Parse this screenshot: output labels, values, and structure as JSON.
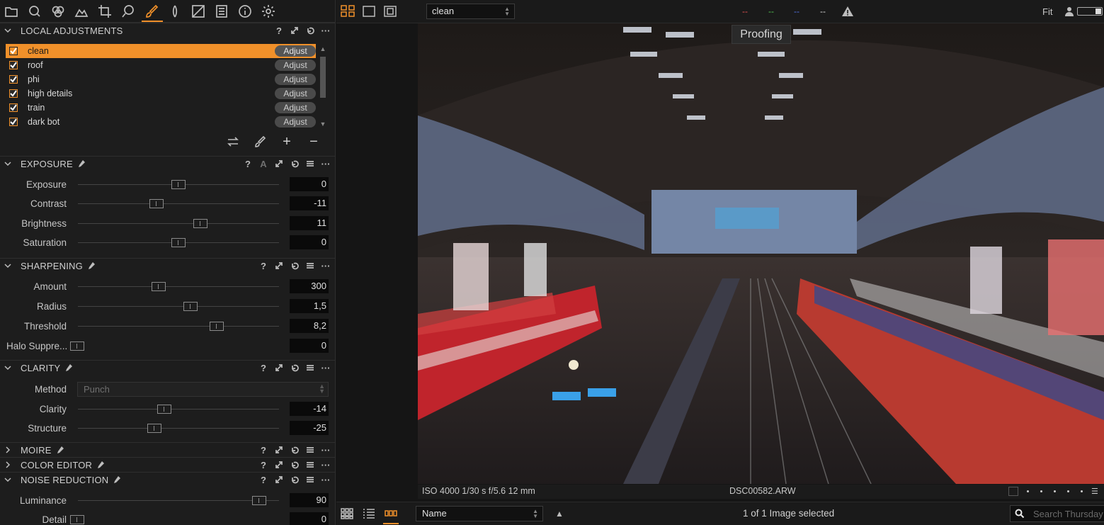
{
  "tool_tabs": [
    "folder-icon",
    "search-icon",
    "color-icon",
    "exposure-icon",
    "crop-icon",
    "lens-icon",
    "adjustments-brush-icon",
    "details-icon",
    "metadata-icon",
    "output-icon",
    "info-icon",
    "settings-icon"
  ],
  "local_adjustments": {
    "title": "LOCAL ADJUSTMENTS",
    "layers": [
      {
        "name": "clean",
        "action": "Adjust",
        "checked": true,
        "selected": true
      },
      {
        "name": "roof",
        "action": "Adjust",
        "checked": true,
        "selected": false
      },
      {
        "name": "phi",
        "action": "Adjust",
        "checked": true,
        "selected": false
      },
      {
        "name": "high details",
        "action": "Adjust",
        "checked": true,
        "selected": false
      },
      {
        "name": "train",
        "action": "Adjust",
        "checked": true,
        "selected": false
      },
      {
        "name": "dark bot",
        "action": "Adjust",
        "checked": true,
        "selected": false
      }
    ],
    "tools": [
      "+",
      "−"
    ]
  },
  "exposure": {
    "title": "EXPOSURE",
    "auto_label": "A",
    "sliders": [
      {
        "label": "Exposure",
        "value": "0",
        "pos": 0.5
      },
      {
        "label": "Contrast",
        "value": "-11",
        "pos": 0.39
      },
      {
        "label": "Brightness",
        "value": "11",
        "pos": 0.61
      },
      {
        "label": "Saturation",
        "value": "0",
        "pos": 0.5
      }
    ]
  },
  "sharpening": {
    "title": "SHARPENING",
    "sliders": [
      {
        "label": "Amount",
        "value": "300",
        "pos": 0.4
      },
      {
        "label": "Radius",
        "value": "1,5",
        "pos": 0.56
      },
      {
        "label": "Threshold",
        "value": "8,2",
        "pos": 0.69
      }
    ],
    "halo": {
      "label": "Halo Suppre...",
      "value": "0"
    }
  },
  "clarity": {
    "title": "CLARITY",
    "method_label": "Method",
    "method_value": "Punch",
    "sliders": [
      {
        "label": "Clarity",
        "value": "-14",
        "pos": 0.43
      },
      {
        "label": "Structure",
        "value": "-25",
        "pos": 0.38
      }
    ]
  },
  "moire": {
    "title": "MOIRE"
  },
  "color_editor": {
    "title": "COLOR EDITOR"
  },
  "noise_reduction": {
    "title": "NOISE REDUCTION",
    "sliders": [
      {
        "label": "Luminance",
        "value": "90",
        "pos": 0.9
      },
      {
        "label": "Detail",
        "value": "0",
        "pos": 0.0
      }
    ]
  },
  "topbar": {
    "variant": "clean",
    "rgb": [
      "--",
      "--",
      "--",
      "--"
    ],
    "rgb_colors": [
      "#e05050",
      "#50c050",
      "#5070e0",
      "#d0d0d0"
    ],
    "zoom": "Fit"
  },
  "viewer": {
    "proofing_label": "Proofing",
    "exif": "ISO 4000  1/30 s  f/5.6  12 mm",
    "filename": "DSC00582.ARW",
    "photo_description_colors": {
      "roof": "#2b2320",
      "glass": "#6c7ca0",
      "train_red": "#c0242c",
      "platform": "#3a2e2a"
    }
  },
  "bottombar": {
    "sort": "Name",
    "selection_count": "1 of 1 Image selected",
    "search_placeholder": "Search Thursday"
  },
  "accent_color": "#f0902a"
}
